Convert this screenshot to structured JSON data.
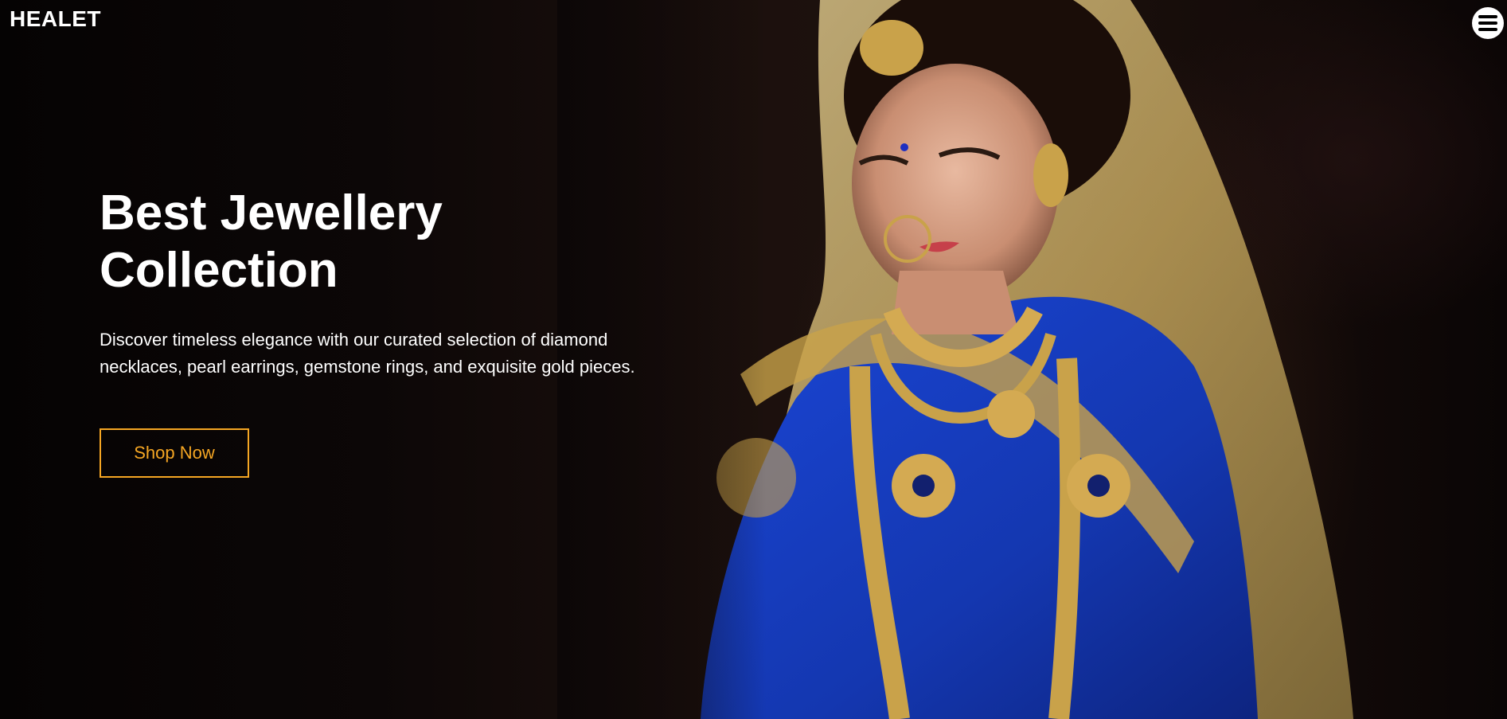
{
  "brand": {
    "logo_text": "HEALET"
  },
  "nav": {
    "menu_icon": "hamburger-menu-icon"
  },
  "hero": {
    "headline_line1": "Best Jewellery",
    "headline_line2": "Collection",
    "description_line1": "Discover timeless elegance with our curated selection of diamond",
    "description_line2": "necklaces, pearl earrings, gemstone rings, and exquisite gold pieces.",
    "cta_label": "Shop Now",
    "background_image": "bride-in-blue-saree-with-gold-jewellery"
  },
  "colors": {
    "accent": "#f5a623",
    "text": "#ffffff",
    "background": "#0a0505",
    "saree_blue": "#1740c8",
    "gold": "#c9a24a"
  }
}
